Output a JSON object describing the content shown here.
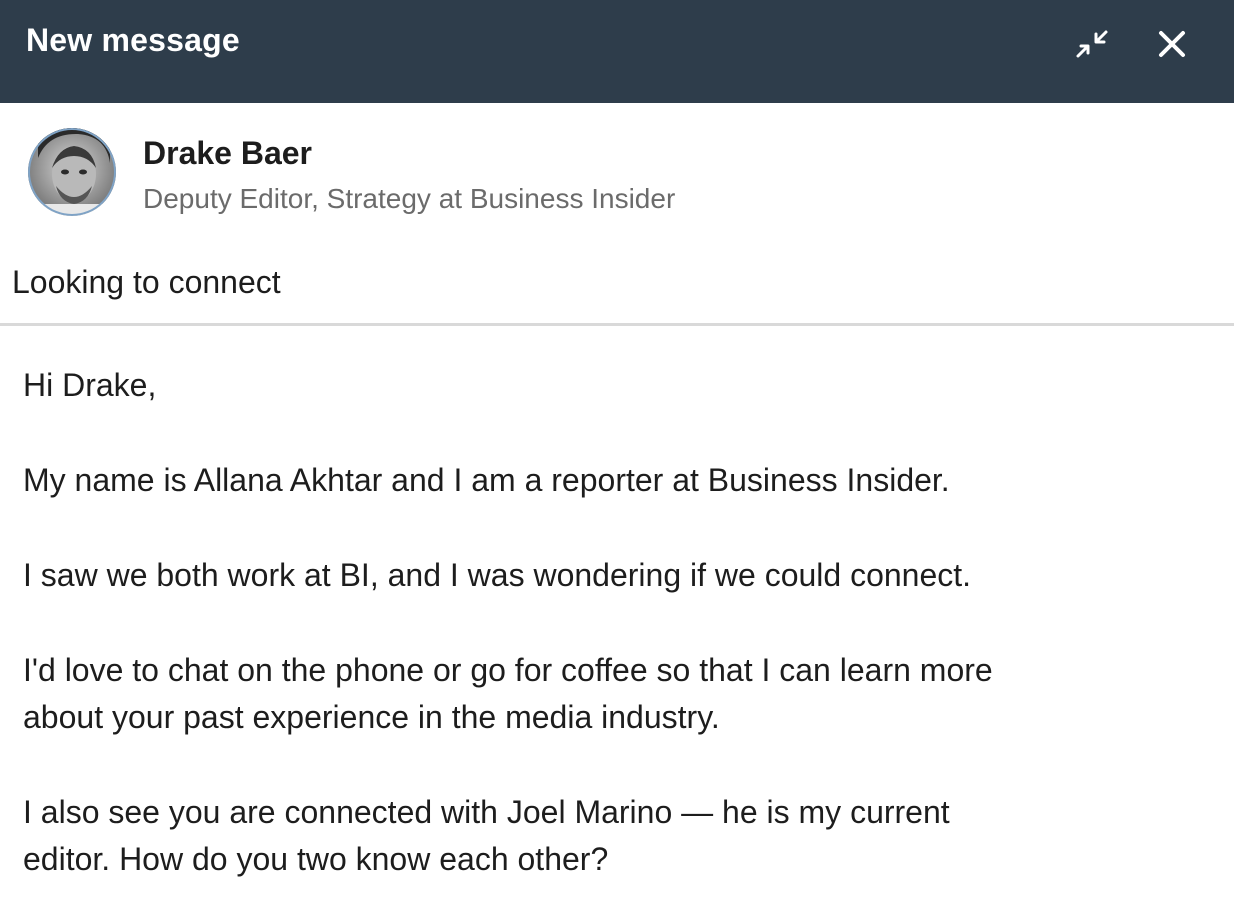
{
  "window": {
    "title": "New message",
    "colors": {
      "titlebar": "#2e3d4b",
      "titlebar_text": "#ffffff",
      "body_text": "#1d1d1d",
      "secondary_text": "#6b6b6b",
      "divider": "#d9d9d9"
    },
    "icons": {
      "minimize": "collapse-arrows-icon",
      "close": "close-icon"
    }
  },
  "recipient": {
    "name": "Drake Baer",
    "headline": "Deputy Editor, Strategy at Business Insider"
  },
  "subject": "Looking to connect",
  "message": {
    "greeting": "Hi Drake,",
    "p1": "My name is Allana Akhtar and I am a reporter at Business Insider.",
    "p2": "I saw we both work at BI, and I was wondering if we could connect.",
    "p3_line1": "I'd love to chat on the phone or go for coffee so that I can learn more",
    "p3_line2": "about your past experience in the media industry.",
    "p4_line1": "I also see you are connected with Joel Marino — he is my current",
    "p4_line2": "editor. How do you two know each other?"
  }
}
